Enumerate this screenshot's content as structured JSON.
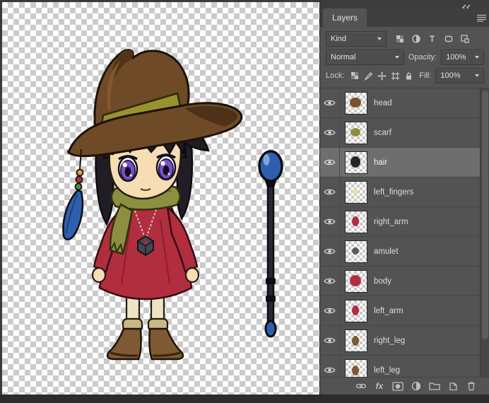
{
  "panel": {
    "tab_label": "Layers",
    "filter_row": {
      "kind_label": "Kind",
      "type_icon": "T"
    },
    "blend_row": {
      "blend_mode": "Normal",
      "opacity_label": "Opacity:",
      "opacity_value": "100%"
    },
    "lock_row": {
      "lock_label": "Lock:",
      "fill_label": "Fill:",
      "fill_value": "100%"
    },
    "layers": [
      {
        "name": "head",
        "thumb_color": "#7a5230",
        "selected": false
      },
      {
        "name": "scarf",
        "thumb_color": "#8c8f3f",
        "selected": false
      },
      {
        "name": "hair",
        "thumb_color": "#26242a",
        "selected": true
      },
      {
        "name": "left_fingers",
        "thumb_color": "#f0dcae",
        "selected": false
      },
      {
        "name": "right_arm",
        "thumb_color": "#b12e3f",
        "selected": false
      },
      {
        "name": "amulet",
        "thumb_color": "#5a5a64",
        "selected": false
      },
      {
        "name": "body",
        "thumb_color": "#b12e3f",
        "selected": false
      },
      {
        "name": "left_arm",
        "thumb_color": "#b12e3f",
        "selected": false
      },
      {
        "name": "right_leg",
        "thumb_color": "#7d5a33",
        "selected": false
      },
      {
        "name": "left_leg",
        "thumb_color": "#7d5a33",
        "selected": false
      }
    ],
    "bottom_bar": {
      "fx_label": "fx"
    },
    "colors": {
      "panel_bg": "#535353",
      "selected_row": "#6e6e6e"
    }
  },
  "art": {
    "hat_color": "#6f4a27",
    "hat_band_color": "#97942f",
    "hair_color": "#201e24",
    "skin_color": "#f6ddb4",
    "eye_color": "#7b52c8",
    "scarf_color": "#8c8f3f",
    "dress_color": "#b12e3f",
    "legging_color": "#eee3c3",
    "boot_color": "#7d5a33",
    "orb_color": "#2e5fae",
    "feather_color": "#2e5fae"
  }
}
